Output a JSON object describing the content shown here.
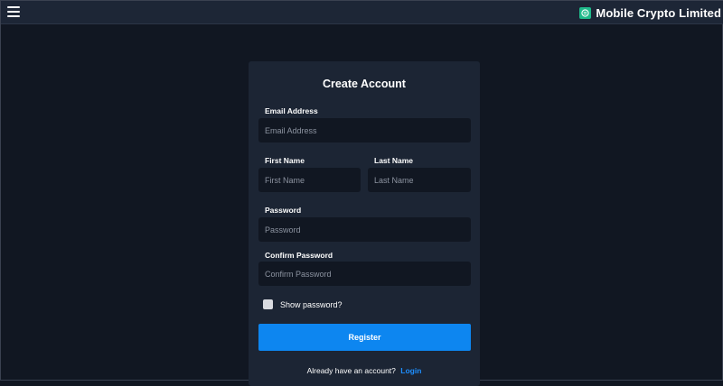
{
  "header": {
    "menu_icon": "hamburger-icon",
    "brand_icon": "crypto-logo-icon",
    "brand_name": "Mobile Crypto Limited"
  },
  "form": {
    "title": "Create Account",
    "email": {
      "label": "Email Address",
      "placeholder": "Email Address",
      "value": ""
    },
    "first_name": {
      "label": "First Name",
      "placeholder": "First Name",
      "value": ""
    },
    "last_name": {
      "label": "Last Name",
      "placeholder": "Last Name",
      "value": ""
    },
    "password": {
      "label": "Password",
      "placeholder": "Password",
      "value": ""
    },
    "confirm_password": {
      "label": "Confirm Password",
      "placeholder": "Confirm Password",
      "value": ""
    },
    "show_password": {
      "label": "Show password?",
      "checked": false
    },
    "register_label": "Register",
    "footer_text": "Already have an account?",
    "login_label": "Login"
  },
  "colors": {
    "background": "#111722",
    "topbar": "#1d2636",
    "card": "#1c2534",
    "input": "#111722",
    "primary": "#0d86f0",
    "link": "#1e8fff",
    "brand_logo": "#1fb98a"
  }
}
